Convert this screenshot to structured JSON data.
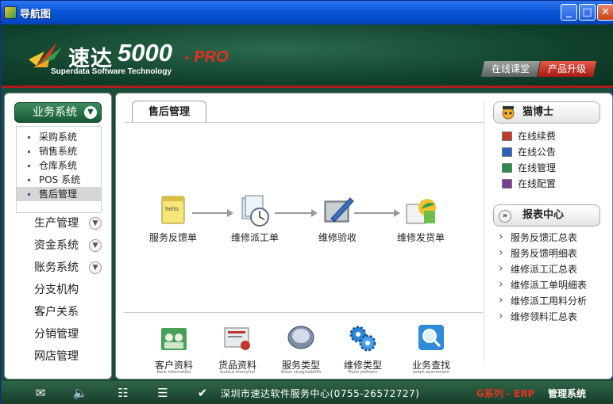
{
  "window": {
    "title": "导航图"
  },
  "window_controls": {
    "minimize": "_",
    "maximize": "□",
    "close": "✕"
  },
  "banner": {
    "brand_cn": "速达",
    "brand_num": "5000",
    "brand_pro": "- PRO",
    "brand_en": "Superdata Software Technology",
    "online_class": "在线课堂",
    "upgrade": "产品升级"
  },
  "sidebar": {
    "group_label": "业务系统",
    "sub_items": [
      "采购系统",
      "销售系统",
      "仓库系统",
      "POS 系统",
      "售后管理"
    ],
    "active_sub": "售后管理",
    "items": [
      "生产管理",
      "资金系统",
      "账务系统",
      "分支机构",
      "客户关系",
      "分销管理",
      "网店管理"
    ]
  },
  "main": {
    "tab": "售后管理",
    "flow": [
      "服务反馈单",
      "维修派工单",
      "维修验收",
      "维修发货单"
    ],
    "bottom": [
      {
        "label": "客户资料",
        "sub": "Bank informatibn"
      },
      {
        "label": "货品资料",
        "sub": "itudeus blooryfral"
      },
      {
        "label": "服务类型",
        "sub": "ithoss stooghatbtiffs"
      },
      {
        "label": "维修类型",
        "sub": "Mytie jsblfaons"
      },
      {
        "label": "业务查找",
        "sub": "zetqik apwrtsment"
      }
    ]
  },
  "right": {
    "doctor": "猫博士",
    "links": [
      "在线续费",
      "在线公告",
      "在线管理",
      "在线配置"
    ],
    "report_head": "报表中心",
    "report_icon": "»",
    "reports": [
      "服务反馈汇总表",
      "服务反馈明细表",
      "维修派工汇总表",
      "维修派工单明细表",
      "维修派工用料分析",
      "维修领料汇总表"
    ]
  },
  "statusbar": {
    "text": "深圳市速达软件服务中心(0755-26572727)",
    "g_series": "G系列 - ERP",
    "erp": "管理系统"
  },
  "colors": {
    "brand_red": "#e82e1f",
    "banner_green": "#1a4d38",
    "titlebar_blue": "#0a55d8"
  }
}
